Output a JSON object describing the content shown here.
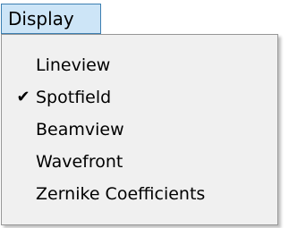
{
  "menubar": {
    "display_label": "Display"
  },
  "menu": {
    "items": [
      {
        "label": "Lineview",
        "checked": false
      },
      {
        "label": "Spotfield",
        "checked": true
      },
      {
        "label": "Beamview",
        "checked": false
      },
      {
        "label": "Wavefront",
        "checked": false
      },
      {
        "label": "Zernike Coefficients",
        "checked": false
      }
    ],
    "check_glyph": "✔",
    "check_icon_name": "checkmark-icon"
  },
  "colors": {
    "menubar_highlight": "#cde5f7",
    "menubar_border": "#3c7fb1",
    "menu_background": "#f0f0f0",
    "menu_border": "#979797"
  }
}
